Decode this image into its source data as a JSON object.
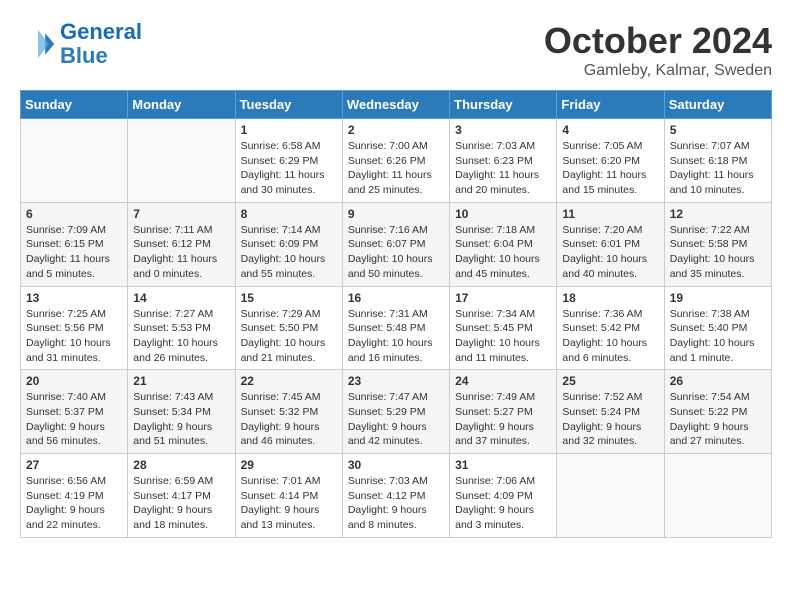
{
  "header": {
    "logo_line1": "General",
    "logo_line2": "Blue",
    "month": "October 2024",
    "location": "Gamleby, Kalmar, Sweden"
  },
  "days_of_week": [
    "Sunday",
    "Monday",
    "Tuesday",
    "Wednesday",
    "Thursday",
    "Friday",
    "Saturday"
  ],
  "weeks": [
    [
      {
        "day": null,
        "detail": null
      },
      {
        "day": null,
        "detail": null
      },
      {
        "day": "1",
        "detail": "Sunrise: 6:58 AM\nSunset: 6:29 PM\nDaylight: 11 hours and 30 minutes."
      },
      {
        "day": "2",
        "detail": "Sunrise: 7:00 AM\nSunset: 6:26 PM\nDaylight: 11 hours and 25 minutes."
      },
      {
        "day": "3",
        "detail": "Sunrise: 7:03 AM\nSunset: 6:23 PM\nDaylight: 11 hours and 20 minutes."
      },
      {
        "day": "4",
        "detail": "Sunrise: 7:05 AM\nSunset: 6:20 PM\nDaylight: 11 hours and 15 minutes."
      },
      {
        "day": "5",
        "detail": "Sunrise: 7:07 AM\nSunset: 6:18 PM\nDaylight: 11 hours and 10 minutes."
      }
    ],
    [
      {
        "day": "6",
        "detail": "Sunrise: 7:09 AM\nSunset: 6:15 PM\nDaylight: 11 hours and 5 minutes."
      },
      {
        "day": "7",
        "detail": "Sunrise: 7:11 AM\nSunset: 6:12 PM\nDaylight: 11 hours and 0 minutes."
      },
      {
        "day": "8",
        "detail": "Sunrise: 7:14 AM\nSunset: 6:09 PM\nDaylight: 10 hours and 55 minutes."
      },
      {
        "day": "9",
        "detail": "Sunrise: 7:16 AM\nSunset: 6:07 PM\nDaylight: 10 hours and 50 minutes."
      },
      {
        "day": "10",
        "detail": "Sunrise: 7:18 AM\nSunset: 6:04 PM\nDaylight: 10 hours and 45 minutes."
      },
      {
        "day": "11",
        "detail": "Sunrise: 7:20 AM\nSunset: 6:01 PM\nDaylight: 10 hours and 40 minutes."
      },
      {
        "day": "12",
        "detail": "Sunrise: 7:22 AM\nSunset: 5:58 PM\nDaylight: 10 hours and 35 minutes."
      }
    ],
    [
      {
        "day": "13",
        "detail": "Sunrise: 7:25 AM\nSunset: 5:56 PM\nDaylight: 10 hours and 31 minutes."
      },
      {
        "day": "14",
        "detail": "Sunrise: 7:27 AM\nSunset: 5:53 PM\nDaylight: 10 hours and 26 minutes."
      },
      {
        "day": "15",
        "detail": "Sunrise: 7:29 AM\nSunset: 5:50 PM\nDaylight: 10 hours and 21 minutes."
      },
      {
        "day": "16",
        "detail": "Sunrise: 7:31 AM\nSunset: 5:48 PM\nDaylight: 10 hours and 16 minutes."
      },
      {
        "day": "17",
        "detail": "Sunrise: 7:34 AM\nSunset: 5:45 PM\nDaylight: 10 hours and 11 minutes."
      },
      {
        "day": "18",
        "detail": "Sunrise: 7:36 AM\nSunset: 5:42 PM\nDaylight: 10 hours and 6 minutes."
      },
      {
        "day": "19",
        "detail": "Sunrise: 7:38 AM\nSunset: 5:40 PM\nDaylight: 10 hours and 1 minute."
      }
    ],
    [
      {
        "day": "20",
        "detail": "Sunrise: 7:40 AM\nSunset: 5:37 PM\nDaylight: 9 hours and 56 minutes."
      },
      {
        "day": "21",
        "detail": "Sunrise: 7:43 AM\nSunset: 5:34 PM\nDaylight: 9 hours and 51 minutes."
      },
      {
        "day": "22",
        "detail": "Sunrise: 7:45 AM\nSunset: 5:32 PM\nDaylight: 9 hours and 46 minutes."
      },
      {
        "day": "23",
        "detail": "Sunrise: 7:47 AM\nSunset: 5:29 PM\nDaylight: 9 hours and 42 minutes."
      },
      {
        "day": "24",
        "detail": "Sunrise: 7:49 AM\nSunset: 5:27 PM\nDaylight: 9 hours and 37 minutes."
      },
      {
        "day": "25",
        "detail": "Sunrise: 7:52 AM\nSunset: 5:24 PM\nDaylight: 9 hours and 32 minutes."
      },
      {
        "day": "26",
        "detail": "Sunrise: 7:54 AM\nSunset: 5:22 PM\nDaylight: 9 hours and 27 minutes."
      }
    ],
    [
      {
        "day": "27",
        "detail": "Sunrise: 6:56 AM\nSunset: 4:19 PM\nDaylight: 9 hours and 22 minutes."
      },
      {
        "day": "28",
        "detail": "Sunrise: 6:59 AM\nSunset: 4:17 PM\nDaylight: 9 hours and 18 minutes."
      },
      {
        "day": "29",
        "detail": "Sunrise: 7:01 AM\nSunset: 4:14 PM\nDaylight: 9 hours and 13 minutes."
      },
      {
        "day": "30",
        "detail": "Sunrise: 7:03 AM\nSunset: 4:12 PM\nDaylight: 9 hours and 8 minutes."
      },
      {
        "day": "31",
        "detail": "Sunrise: 7:06 AM\nSunset: 4:09 PM\nDaylight: 9 hours and 3 minutes."
      },
      {
        "day": null,
        "detail": null
      },
      {
        "day": null,
        "detail": null
      }
    ]
  ]
}
